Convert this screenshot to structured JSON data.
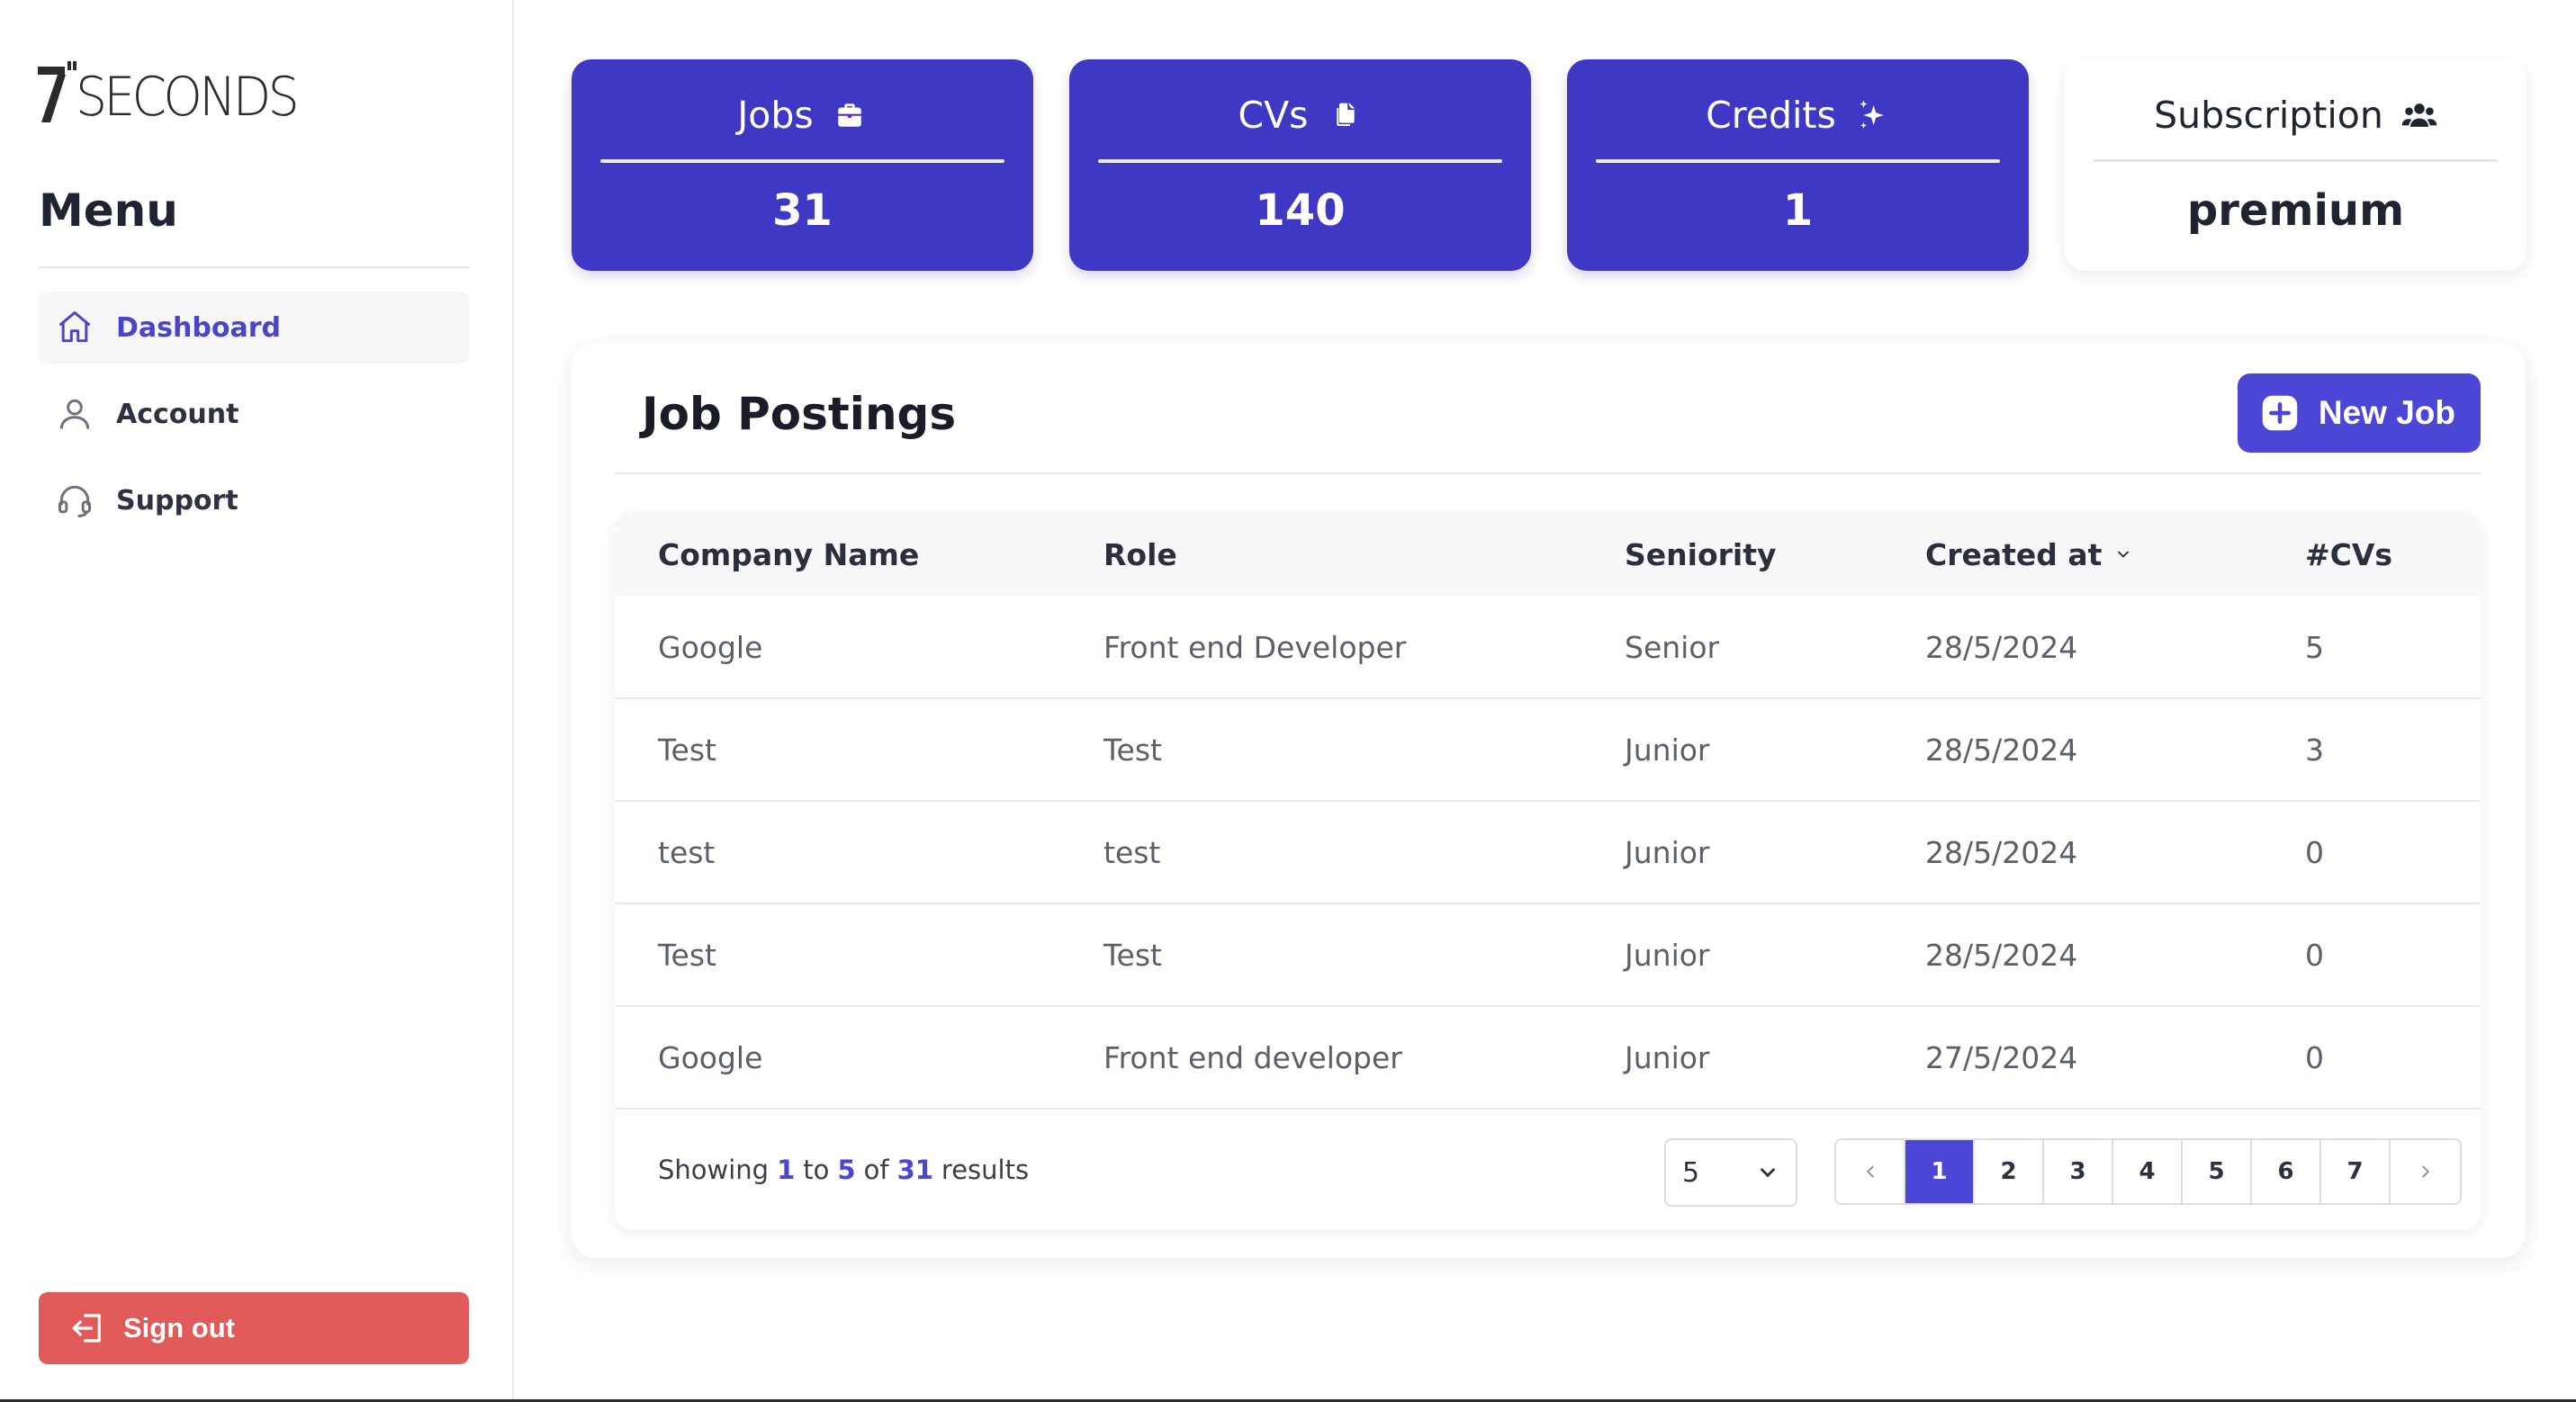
{
  "brand": {
    "logo_text": "SECONDS",
    "logo_digit": "7"
  },
  "sidebar": {
    "menu_title": "Menu",
    "items": [
      {
        "label": "Dashboard",
        "icon": "home-icon",
        "active": true
      },
      {
        "label": "Account",
        "icon": "user-icon",
        "active": false
      },
      {
        "label": "Support",
        "icon": "headset-icon",
        "active": false
      }
    ],
    "signout_label": "Sign out"
  },
  "stats": [
    {
      "label": "Jobs",
      "value": "31",
      "icon": "briefcase-icon"
    },
    {
      "label": "CVs",
      "value": "140",
      "icon": "copy-icon"
    },
    {
      "label": "Credits",
      "value": "1",
      "icon": "sparkles-icon"
    },
    {
      "label": "Subscription",
      "value": "premium",
      "icon": "users-icon"
    }
  ],
  "postings": {
    "title": "Job Postings",
    "new_job_label": "New Job",
    "columns": [
      "Company Name",
      "Role",
      "Seniority",
      "Created at",
      "#CVs"
    ],
    "rows": [
      [
        "Google",
        "Front end Developer",
        "Senior",
        "28/5/2024",
        "5"
      ],
      [
        "Test",
        "Test",
        "Junior",
        "28/5/2024",
        "3"
      ],
      [
        "test",
        "test",
        "Junior",
        "28/5/2024",
        "0"
      ],
      [
        "Test",
        "Test",
        "Junior",
        "28/5/2024",
        "0"
      ],
      [
        "Google",
        "Front end developer",
        "Junior",
        "27/5/2024",
        "0"
      ]
    ],
    "footer": {
      "showing": "Showing",
      "from": "1",
      "to_word": "to",
      "to": "5",
      "of_word": "of",
      "total": "31",
      "results_word": "results",
      "page_size": "5",
      "pages": [
        "1",
        "2",
        "3",
        "4",
        "5",
        "6",
        "7"
      ],
      "current_page": "1"
    }
  },
  "colors": {
    "accent": "#3f38c4",
    "button": "#4c46d6",
    "signout": "#e05a5a",
    "sidebar_active_text": "#4a44c6"
  }
}
